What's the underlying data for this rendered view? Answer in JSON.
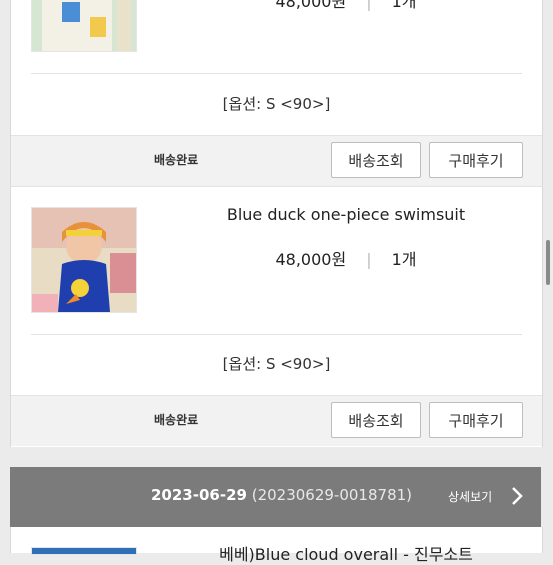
{
  "items": [
    {
      "name": "",
      "price": "48,000원",
      "qty": "1개",
      "option": "[옵션: S <90>]",
      "status": "배송완료",
      "track_label": "배송조회",
      "review_label": "구매후기"
    },
    {
      "name": "Blue duck one-piece swimsuit",
      "price": "48,000원",
      "qty": "1개",
      "option": "[옵션: S <90>]",
      "status": "배송완료",
      "track_label": "배송조회",
      "review_label": "구매후기"
    }
  ],
  "next_order": {
    "date": "2023-06-29",
    "order_no": "(20230629-0018781)",
    "detail_label": "상세보기",
    "first_item_name": "베베)Blue cloud overall - 진무소트"
  },
  "colors": {
    "header_bg": "#7b7b7b",
    "status_bg": "#f2f2f2"
  }
}
